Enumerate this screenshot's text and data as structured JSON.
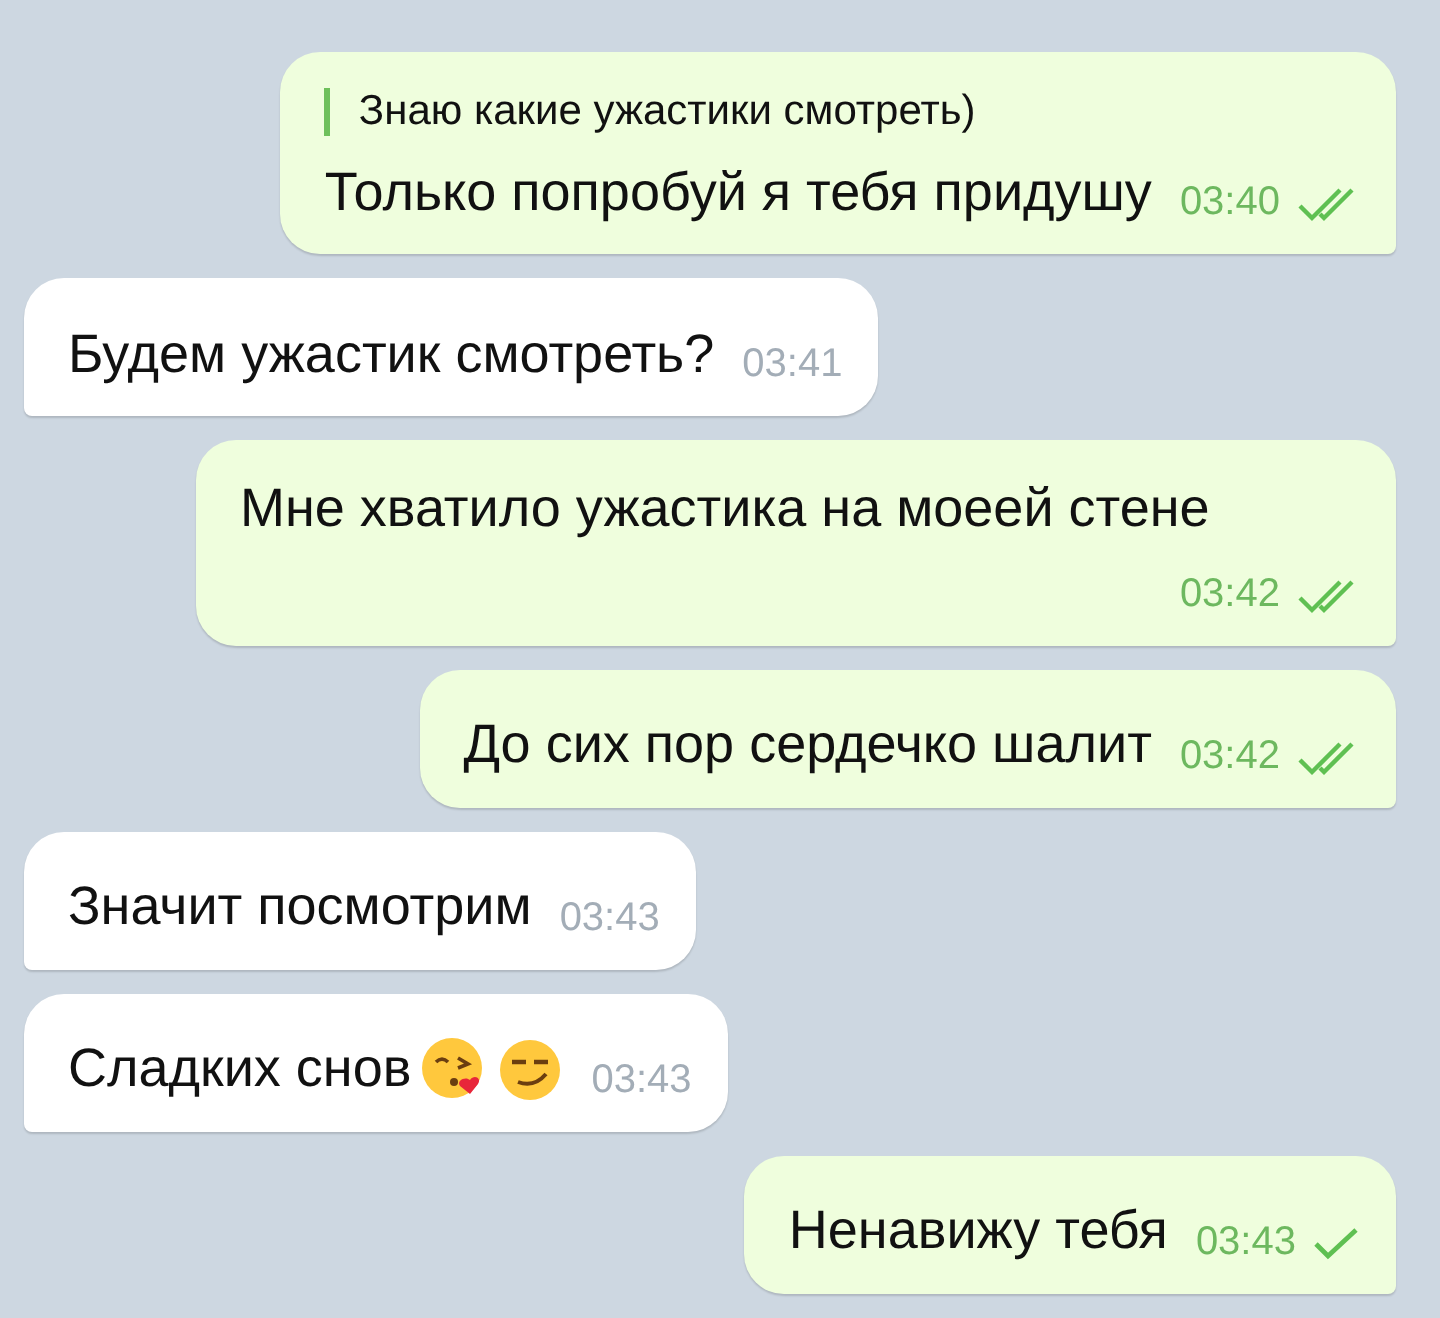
{
  "messages": [
    {
      "kind": "outgoing",
      "quote": "Знаю какие ужастики смотреть)",
      "text": "Только попробуй я тебя придушу",
      "time": "03:40",
      "read": true
    },
    {
      "kind": "incoming",
      "text": "Будем ужастик смотреть?",
      "time": "03:41"
    },
    {
      "kind": "outgoing",
      "text": "Мне хватило ужастика на моеей стене",
      "time": "03:42",
      "read": true
    },
    {
      "kind": "outgoing",
      "text": "До сих пор сердечко шалит",
      "time": "03:42",
      "read": true
    },
    {
      "kind": "incoming",
      "text": "Значит посмотрим",
      "time": "03:43"
    },
    {
      "kind": "incoming",
      "text": "Сладких снов",
      "emojis": [
        {
          "kind": "kiss"
        },
        {
          "kind": "smirk"
        }
      ],
      "time": "03:43"
    },
    {
      "kind": "outgoing",
      "text": "Ненавижу тебя",
      "time": "03:43",
      "read": false
    }
  ]
}
